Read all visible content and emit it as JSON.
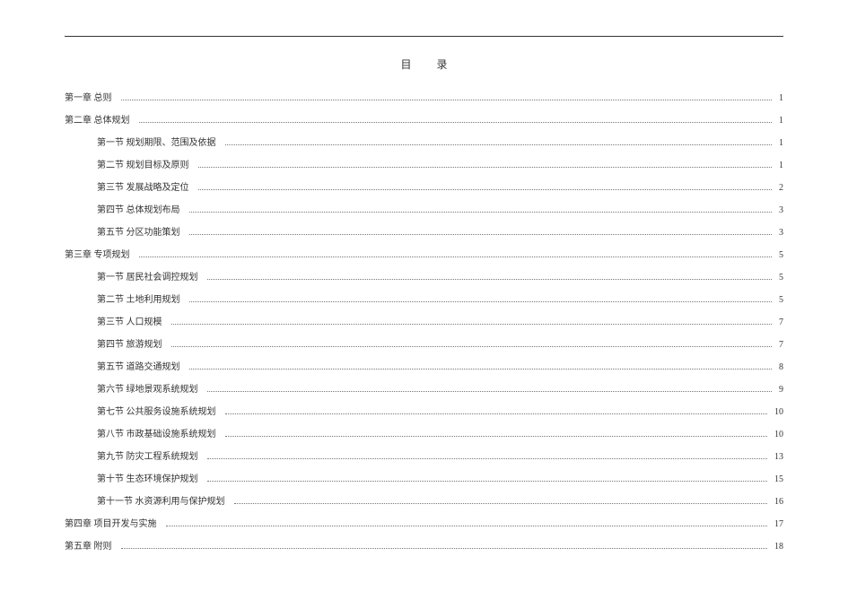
{
  "title": "目录",
  "toc": [
    {
      "level": 0,
      "label": "第一章  总则",
      "page": "1"
    },
    {
      "level": 0,
      "label": "第二章  总体规划",
      "page": "1"
    },
    {
      "level": 1,
      "label": "第一节  规划期限、范围及依据",
      "page": "1"
    },
    {
      "level": 1,
      "label": "第二节  规划目标及原则",
      "page": "1"
    },
    {
      "level": 1,
      "label": "第三节  发展战略及定位",
      "page": "2"
    },
    {
      "level": 1,
      "label": "第四节  总体规划布局",
      "page": "3"
    },
    {
      "level": 1,
      "label": "第五节  分区功能策划",
      "page": "3"
    },
    {
      "level": 0,
      "label": "第三章  专项规划",
      "page": "5"
    },
    {
      "level": 1,
      "label": "第一节  居民社会调控规划",
      "page": "5"
    },
    {
      "level": 1,
      "label": "第二节  土地利用规划",
      "page": "5"
    },
    {
      "level": 1,
      "label": "第三节  人口规模",
      "page": "7"
    },
    {
      "level": 1,
      "label": "第四节  旅游规划",
      "page": "7"
    },
    {
      "level": 1,
      "label": "第五节  道路交通规划",
      "page": "8"
    },
    {
      "level": 1,
      "label": "第六节  绿地景观系统规划",
      "page": "9"
    },
    {
      "level": 1,
      "label": "第七节  公共服务设施系统规划",
      "page": "10"
    },
    {
      "level": 1,
      "label": "第八节  市政基础设施系统规划",
      "page": "10"
    },
    {
      "level": 1,
      "label": "第九节  防灾工程系统规划",
      "page": "13"
    },
    {
      "level": 1,
      "label": "第十节  生态环境保护规划",
      "page": "15"
    },
    {
      "level": 1,
      "label": "第十一节  水资源利用与保护规划",
      "page": "16"
    },
    {
      "level": 0,
      "label": "第四章  项目开发与实施",
      "page": "17"
    },
    {
      "level": 0,
      "label": "第五章  附则",
      "page": "18"
    }
  ]
}
